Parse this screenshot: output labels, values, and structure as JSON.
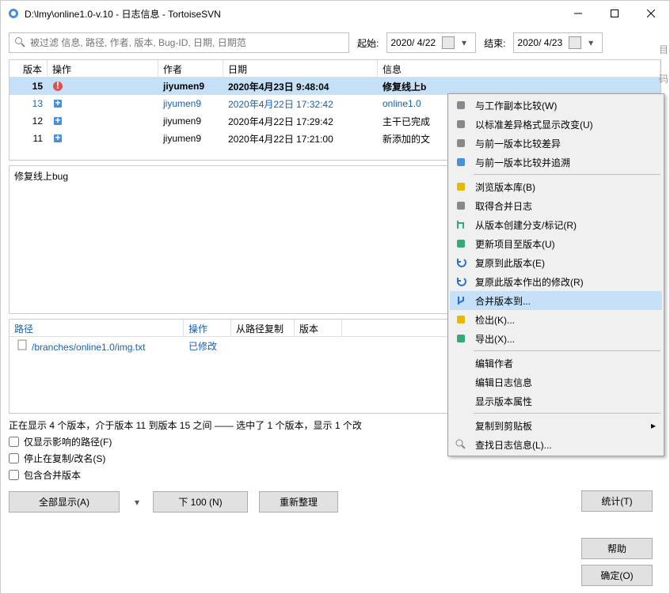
{
  "window": {
    "title": "D:\\lmy\\online1.0-v.10 - 日志信息 - TortoiseSVN"
  },
  "search": {
    "placeholder": "被过滤 信息, 路径, 作者, 版本, Bug-ID, 日期, 日期范"
  },
  "date": {
    "from_label": "起始:",
    "from_value": "2020/ 4/22",
    "to_label": "结束:",
    "to_value": "2020/ 4/23"
  },
  "log": {
    "headers": {
      "rev": "版本",
      "act": "操作",
      "auth": "作者",
      "date": "日期",
      "msg": "信息"
    },
    "rows": [
      {
        "rev": "15",
        "auth": "jiyumen9",
        "date": "2020年4月23日 9:48:04",
        "msg": "修复线上b",
        "selected": true,
        "link": false,
        "icon": "modified"
      },
      {
        "rev": "13",
        "auth": "jiyumen9",
        "date": "2020年4月22日 17:32:42",
        "msg": "online1.0",
        "selected": false,
        "link": true,
        "icon": "added"
      },
      {
        "rev": "12",
        "auth": "jiyumen9",
        "date": "2020年4月22日 17:29:42",
        "msg": "主干已完成",
        "selected": false,
        "link": false,
        "icon": "added"
      },
      {
        "rev": "11",
        "auth": "jiyumen9",
        "date": "2020年4月22日 17:21:00",
        "msg": "新添加的文",
        "selected": false,
        "link": false,
        "icon": "added"
      }
    ]
  },
  "message": {
    "text": "修复线上bug"
  },
  "paths": {
    "headers": {
      "path": "路径",
      "act": "操作",
      "copy": "从路径复制",
      "rev": "版本"
    },
    "rows": [
      {
        "path": "/branches/online1.0/img.txt",
        "act": "已修改"
      }
    ]
  },
  "status": "正在显示 4 个版本，介于版本 11 到版本 15 之间 —— 选中了 1 个版本，显示 1 个改",
  "checks": {
    "c1": "仅显示影响的路径(F)",
    "c2": "停止在复制/改名(S)",
    "c3": "包含合并版本"
  },
  "buttons": {
    "showall": "全部显示(A)",
    "next": "下 100 (N)",
    "refresh": "重新整理",
    "stat": "统计(T)",
    "help": "帮助",
    "ok": "确定(O)"
  },
  "context": {
    "items": [
      {
        "icon": "compare",
        "text": "与工作副本比较(W)"
      },
      {
        "icon": "diff",
        "text": "以标准差异格式显示改变(U)"
      },
      {
        "icon": "compare",
        "text": "与前一版本比较差异"
      },
      {
        "icon": "blame",
        "text": "与前一版本比较并追溯"
      },
      {
        "sep": true
      },
      {
        "icon": "repo",
        "text": "浏览版本库(B)"
      },
      {
        "icon": "log",
        "text": "取得合并日志"
      },
      {
        "icon": "branch",
        "text": "从版本创建分支/标记(R)"
      },
      {
        "icon": "update",
        "text": "更新项目至版本(U)"
      },
      {
        "icon": "revert",
        "text": "复原到此版本(E)"
      },
      {
        "icon": "revert",
        "text": "复原此版本作出的修改(R)"
      },
      {
        "icon": "merge",
        "text": "合并版本到...",
        "hl": true
      },
      {
        "icon": "checkout",
        "text": "检出(K)..."
      },
      {
        "icon": "export",
        "text": "导出(X)..."
      },
      {
        "sep": true
      },
      {
        "icon": "",
        "text": "编辑作者"
      },
      {
        "icon": "",
        "text": "编辑日志信息"
      },
      {
        "icon": "",
        "text": "显示版本属性"
      },
      {
        "sep": true
      },
      {
        "icon": "",
        "text": "复制到剪贴板",
        "arrow": true
      },
      {
        "icon": "search",
        "text": "查找日志信息(L)..."
      }
    ]
  },
  "side": {
    "a": "目",
    "b": "码"
  },
  "watermark": ""
}
